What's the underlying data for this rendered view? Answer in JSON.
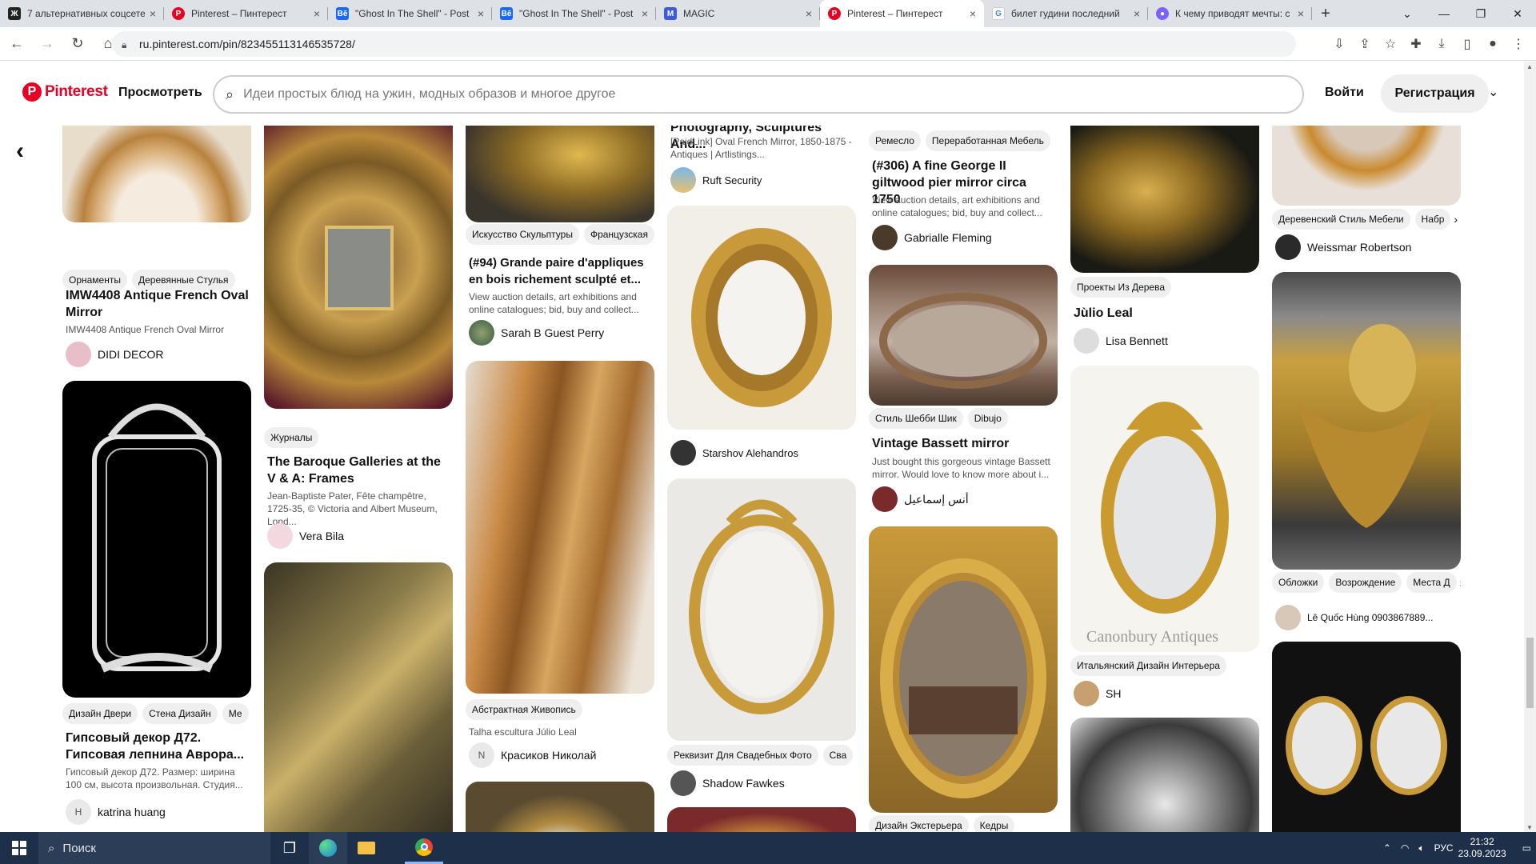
{
  "browser": {
    "tabs": [
      {
        "title": "7 альтернативных соцсетей",
        "icon": "zen-icon",
        "color": "#222222",
        "active": false
      },
      {
        "title": "Pinterest – Пинтерест",
        "icon": "pinterest-icon",
        "color": "#e60023",
        "active": false
      },
      {
        "title": "\"Ghost In The Shell\" - Post",
        "icon": "behance-icon",
        "color": "#1769ff",
        "active": false
      },
      {
        "title": "\"Ghost In The Shell\" - Post",
        "icon": "behance-icon",
        "color": "#1769ff",
        "active": false
      },
      {
        "title": "MAGIC",
        "icon": "magic-icon",
        "color": "#3b5bdb",
        "active": false
      },
      {
        "title": "Pinterest – Пинтерест",
        "icon": "pinterest-icon",
        "color": "#e60023",
        "active": true
      },
      {
        "title": "билет гудини последний",
        "icon": "google-icon",
        "color": "#4285f4",
        "active": false
      },
      {
        "title": "К чему приводят мечты: с",
        "icon": "user-icon",
        "color": "#7b61ff",
        "active": false
      }
    ],
    "url": "ru.pinterest.com/pin/823455113146535728/"
  },
  "header": {
    "logo": "Pinterest",
    "browse": "Просмотреть",
    "search_placeholder": "Идеи простых блюд на ужин, модных образов и многое другое",
    "login": "Войти",
    "signup": "Регистрация"
  },
  "pins": {
    "c1a": {
      "chips": [
        "Орнаменты",
        "Деревянные Стулья"
      ],
      "title": "IMW4408 Antique French Oval Mirror",
      "desc": "IMW4408 Antique French Oval Mirror",
      "author": "DIDI DECOR",
      "avatar": ""
    },
    "c1b": {
      "chips": [
        "Дизайн Двери",
        "Стена Дизайн",
        "Ме"
      ],
      "title": "Гипсовый декор Д72. Гипсовая лепнина Аврора...",
      "desc": "Гипсовый декор Д72. Размер: ширина 100 см, высота произвольная. Студия...",
      "author": "katrina huang",
      "avatar": "H"
    },
    "c2a": {
      "chips": [
        "Журналы"
      ],
      "title": "The Baroque Galleries at the V & A: Frames",
      "desc": "Jean-Baptiste Pater, Fête champêtre, 1725-35, © Victoria and Albert Museum, Lond...",
      "author": "Vera Bila",
      "avatar": ""
    },
    "c3a": {
      "chips": [
        "Искусство Скульптуры",
        "Французская"
      ],
      "title": "(#94) Grande paire d'appliques en bois richement sculpté et...",
      "desc": "View auction details, art exhibitions and online catalogues; bid, buy and collect...",
      "author": "Sarah B Guest Perry",
      "avatar": ""
    },
    "c3b": {
      "chips": [
        "Абстрактная Живопись"
      ],
      "title": "",
      "desc": "Talha escultura Júlio Leal",
      "author": "Красиков Николай",
      "avatar": "N"
    },
    "c4a": {
      "title": "Photography, Sculptures And...",
      "desc": "[PaidLink] Oval French Mirror, 1850-1875 - Antiques | Artlistings...",
      "author": "Ruft Security",
      "avatar": ""
    },
    "c4b": {
      "author": "Starshov Alehandros",
      "avatar": ""
    },
    "c4c": {
      "chips": [
        "Реквизит Для Свадебных Фото",
        "Сва"
      ],
      "author": "Shadow Fawkes",
      "avatar": ""
    },
    "c5a": {
      "chips": [
        "Ремесло",
        "Переработанная Мебель"
      ],
      "title": "(#306) A fine George II giltwood pier mirror circa 1750",
      "desc": "View auction details, art exhibitions and online catalogues; bid, buy and collect...",
      "author": "Gabrialle Fleming",
      "avatar": ""
    },
    "c5b": {
      "chips": [
        "Стиль Шебби Шик",
        "Dibujo"
      ],
      "title": "Vintage Bassett mirror",
      "desc": "Just bought this gorgeous vintage Bassett mirror. Would love to know more about i...",
      "author": "أنس إسماعيل",
      "avatar": ""
    },
    "c5c": {
      "chips": [
        "Дизайн Экстерьера",
        "Кедры"
      ]
    },
    "c6a": {
      "chips": [
        "Проекты Из Дерева"
      ],
      "title": "Jùlio Leal",
      "author": "Lisa Bennett",
      "avatar": ""
    },
    "c6b": {
      "chips": [
        "Итальянский Дизайн Интерьера"
      ],
      "author": "SH",
      "avatar": "",
      "watermark": "Canonbury Antiques"
    },
    "c7a": {
      "chips": [
        "Деревенский Стиль Мебели",
        "Набр"
      ],
      "author": "Weissmar Robertson",
      "avatar": ""
    },
    "c7b": {
      "chips": [
        "Обложки",
        "Возрождение",
        "Места Д"
      ],
      "author": "Lê Quốc Hùng 0903867889...",
      "avatar": ""
    }
  },
  "taskbar": {
    "search": "Поиск",
    "lang": "РУС",
    "time": "21:32",
    "date": "23.09.2023"
  },
  "colors": {
    "accent": "#e60023",
    "chip": "#efefef",
    "gold": "#c89a3c"
  }
}
